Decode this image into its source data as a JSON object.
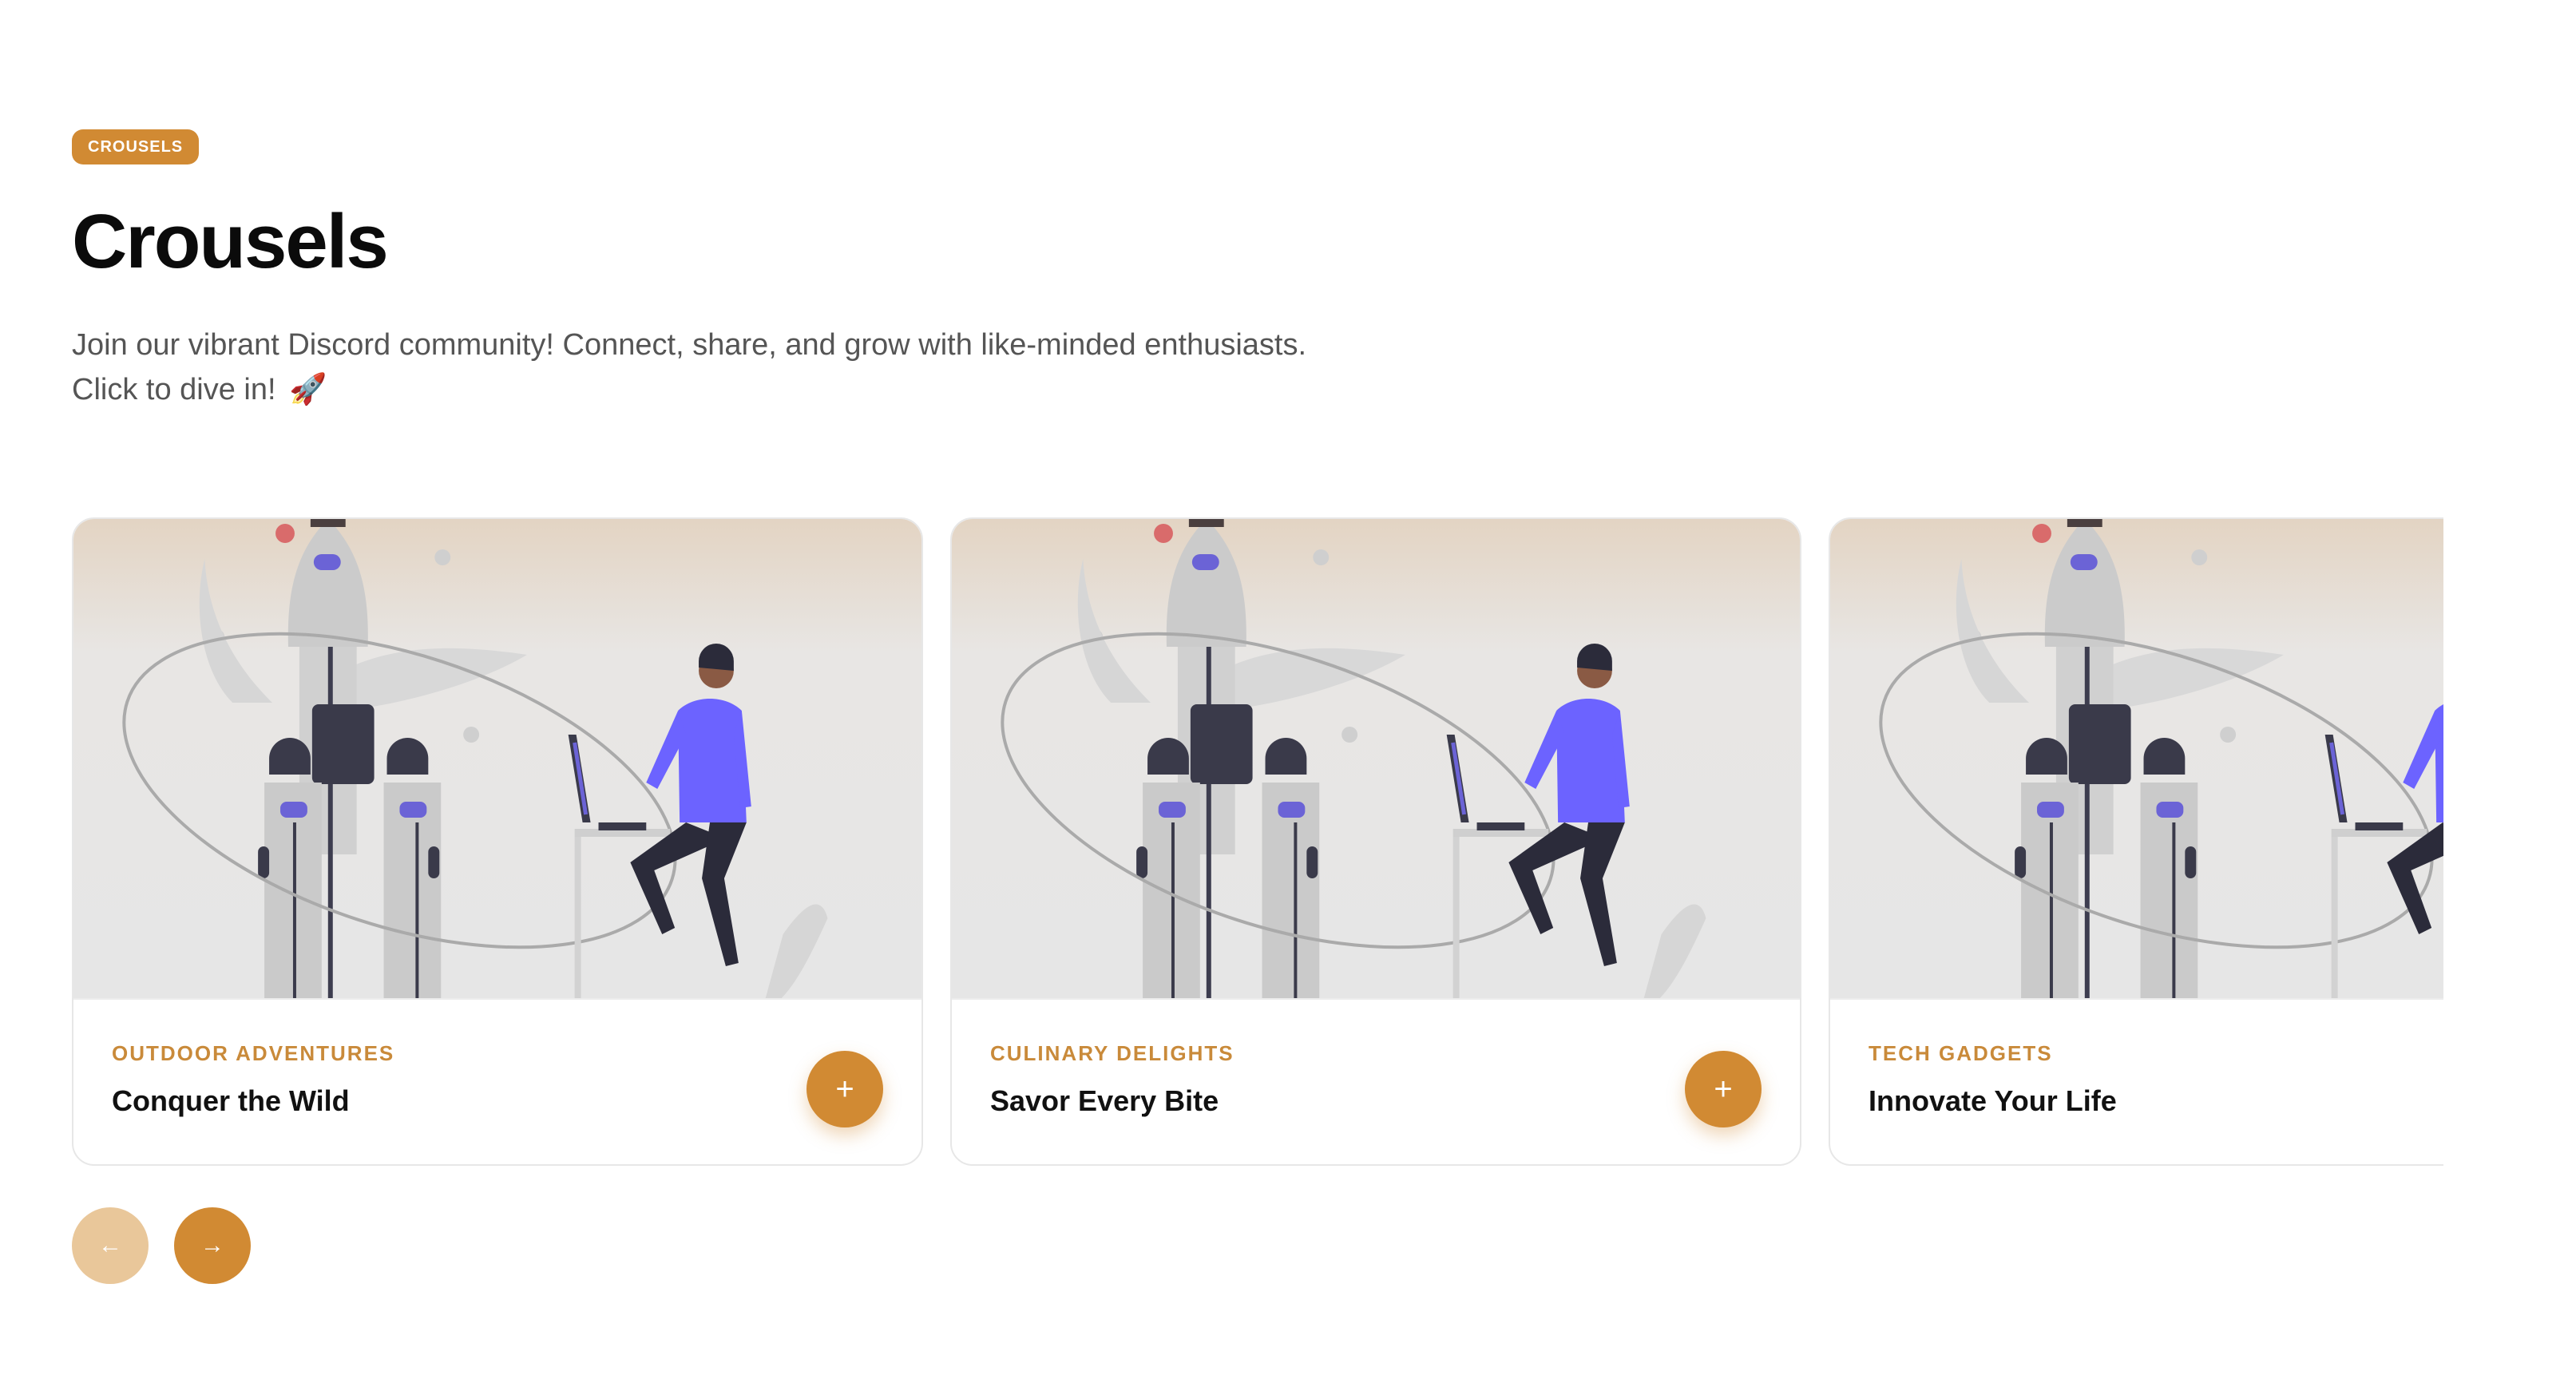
{
  "badge": "CROUSELS",
  "title": "Crousels",
  "subtitle_line1": "Join our vibrant Discord community! Connect, share, and grow with like-minded enthusiasts.",
  "subtitle_line2": "Click to dive in!",
  "rocket_emoji": "🚀",
  "cards": [
    {
      "category": "OUTDOOR ADVENTURES",
      "title": "Conquer the Wild",
      "action_icon": "+"
    },
    {
      "category": "CULINARY DELIGHTS",
      "title": "Savor Every Bite",
      "action_icon": "+"
    },
    {
      "category": "TECH GADGETS",
      "title": "Innovate Your Life",
      "action_icon": "+"
    }
  ],
  "nav": {
    "prev_icon": "←",
    "next_icon": "→"
  },
  "colors": {
    "accent": "#d18a33",
    "accent_light": "#e9c79a",
    "illustration_person": "#6c63ff"
  }
}
